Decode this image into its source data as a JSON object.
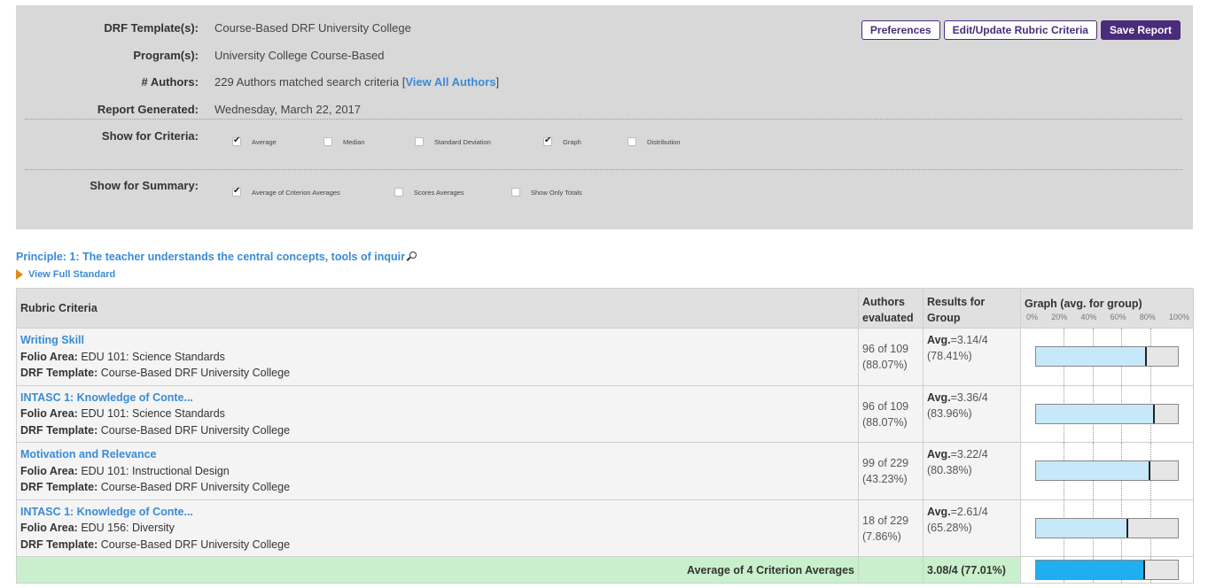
{
  "header": {
    "template_label": "DRF Template(s):",
    "template_value": "Course-Based DRF University College",
    "program_label": "Program(s):",
    "program_value": "University College Course-Based",
    "authors_label": "# Authors:",
    "authors_text": "229 Authors matched search criteria [",
    "authors_link": "View All Authors",
    "authors_close": "]",
    "report_label": "Report Generated:",
    "report_value": "Wednesday, March 22, 2017",
    "criteria_label": "Show for Criteria:",
    "summary_label": "Show for Summary:"
  },
  "criteria_options": [
    {
      "label": "Average",
      "checked": true
    },
    {
      "label": "Median",
      "checked": false
    },
    {
      "label": "Standard Deviation",
      "checked": false
    },
    {
      "label": "Graph",
      "checked": true
    },
    {
      "label": "Distribution",
      "checked": false
    }
  ],
  "summary_options": [
    {
      "label": "Average of Criterion Averages",
      "checked": true
    },
    {
      "label": "Scores Averages",
      "checked": false
    },
    {
      "label": "Show Only Totals",
      "checked": false
    }
  ],
  "buttons": {
    "preferences": "Preferences",
    "edit": "Edit/Update Rubric Criteria",
    "save": "Save Report"
  },
  "principle": {
    "text": "Principle: 1: The teacher understands the central concepts, tools of inquir",
    "view_full": "View Full Standard"
  },
  "table": {
    "headers": {
      "rubric": "Rubric Criteria",
      "authors_1": "Authors",
      "authors_2": "evaluated",
      "results_1": "Results for",
      "results_2": "Group",
      "graph": "Graph (avg. for group)",
      "scale": [
        "0%",
        "20%",
        "40%",
        "60%",
        "80%",
        "100%"
      ]
    },
    "folio_label": "Folio Area:",
    "template_label": "DRF Template:",
    "avg_label": "Avg.",
    "rows": [
      {
        "title": "Writing Skill",
        "folio": "EDU 101: Science Standards",
        "template": "Course-Based DRF University College",
        "evaluated": "96 of 109",
        "evaluated_pct": "(88.07%)",
        "avg": "=3.14/4",
        "pct": "(78.41%)",
        "graph_pct": 78.41
      },
      {
        "title": "INTASC 1: Knowledge of Conte...",
        "folio": "EDU 101: Science Standards",
        "template": "Course-Based DRF University College",
        "evaluated": "96 of 109",
        "evaluated_pct": "(88.07%)",
        "avg": "=3.36/4",
        "pct": "(83.96%)",
        "graph_pct": 83.96
      },
      {
        "title": "Motivation and Relevance",
        "folio": "EDU 101: Instructional Design",
        "template": "Course-Based DRF University College",
        "evaluated": "99 of 229",
        "evaluated_pct": "(43.23%)",
        "avg": "=3.22/4",
        "pct": "(80.38%)",
        "graph_pct": 80.38
      },
      {
        "title": "INTASC 1: Knowledge of Conte...",
        "folio": "EDU 156: Diversity",
        "template": "Course-Based DRF University College",
        "evaluated": "18 of 229",
        "evaluated_pct": "(7.86%)",
        "avg": "=2.61/4",
        "pct": "(65.28%)",
        "graph_pct": 65.28
      }
    ],
    "summary": {
      "label": "Average of 4 Criterion Averages",
      "value": "3.08/4 (77.01%)",
      "graph_pct": 77.01
    }
  }
}
